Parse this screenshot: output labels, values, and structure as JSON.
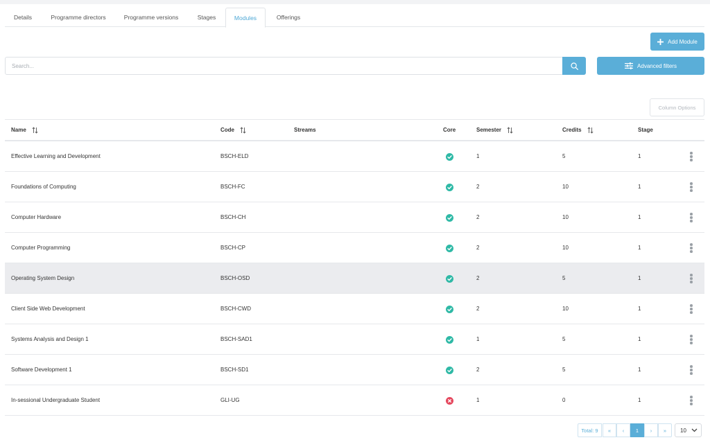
{
  "tabs": [
    {
      "label": "Details"
    },
    {
      "label": "Programme directors"
    },
    {
      "label": "Programme versions"
    },
    {
      "label": "Stages"
    },
    {
      "label": "Modules",
      "active": true
    },
    {
      "label": "Offerings"
    }
  ],
  "toolbar": {
    "add_module_label": "Add Module",
    "search_placeholder": "Search...",
    "advanced_filters_label": "Advanced filters",
    "column_options_label": "Column Options"
  },
  "table": {
    "columns": [
      "Name",
      "Code",
      "Streams",
      "Core",
      "Semester",
      "Credits",
      "Stage"
    ],
    "rows": [
      {
        "name": "Effective Learning and Development",
        "code": "BSCH-ELD",
        "streams": "",
        "core": true,
        "semester": "1",
        "credits": "5",
        "stage": "1"
      },
      {
        "name": "Foundations of Computing",
        "code": "BSCH-FC",
        "streams": "",
        "core": true,
        "semester": "2",
        "credits": "10",
        "stage": "1"
      },
      {
        "name": "Computer Hardware",
        "code": "BSCH-CH",
        "streams": "",
        "core": true,
        "semester": "2",
        "credits": "10",
        "stage": "1"
      },
      {
        "name": "Computer Programming",
        "code": "BSCH-CP",
        "streams": "",
        "core": true,
        "semester": "2",
        "credits": "10",
        "stage": "1"
      },
      {
        "name": "Operating System Design",
        "code": "BSCH-OSD",
        "streams": "",
        "core": true,
        "semester": "2",
        "credits": "5",
        "stage": "1"
      },
      {
        "name": "Client Side Web Development",
        "code": "BSCH-CWD",
        "streams": "",
        "core": true,
        "semester": "2",
        "credits": "10",
        "stage": "1"
      },
      {
        "name": "Systems Analysis and Design 1",
        "code": "BSCH-SAD1",
        "streams": "",
        "core": true,
        "semester": "1",
        "credits": "5",
        "stage": "1"
      },
      {
        "name": "Software Development 1",
        "code": "BSCH-SD1",
        "streams": "",
        "core": true,
        "semester": "2",
        "credits": "5",
        "stage": "1"
      },
      {
        "name": "In-sessional Undergraduate Student",
        "code": "GLI-UG",
        "streams": "",
        "core": false,
        "semester": "1",
        "credits": "0",
        "stage": "1"
      }
    ]
  },
  "pagination": {
    "total_label": "Total: 9",
    "first_label": "«",
    "prev_label": "‹",
    "current_page": "1",
    "next_label": "›",
    "last_label": "»",
    "page_size": "10"
  },
  "colors": {
    "accent": "#5aaed8",
    "core_yes": "#2fb9a6",
    "core_no": "#e5485e",
    "highlight_row": "#ebecef"
  },
  "icons": {
    "add": "plus-icon",
    "search": "search-icon",
    "filters": "sliders-icon",
    "sort": "sort-icon",
    "core_yes": "check-circle-icon",
    "core_no": "x-circle-icon",
    "row_menu": "kebab-icon",
    "page_size": "chevron-down-icon"
  }
}
